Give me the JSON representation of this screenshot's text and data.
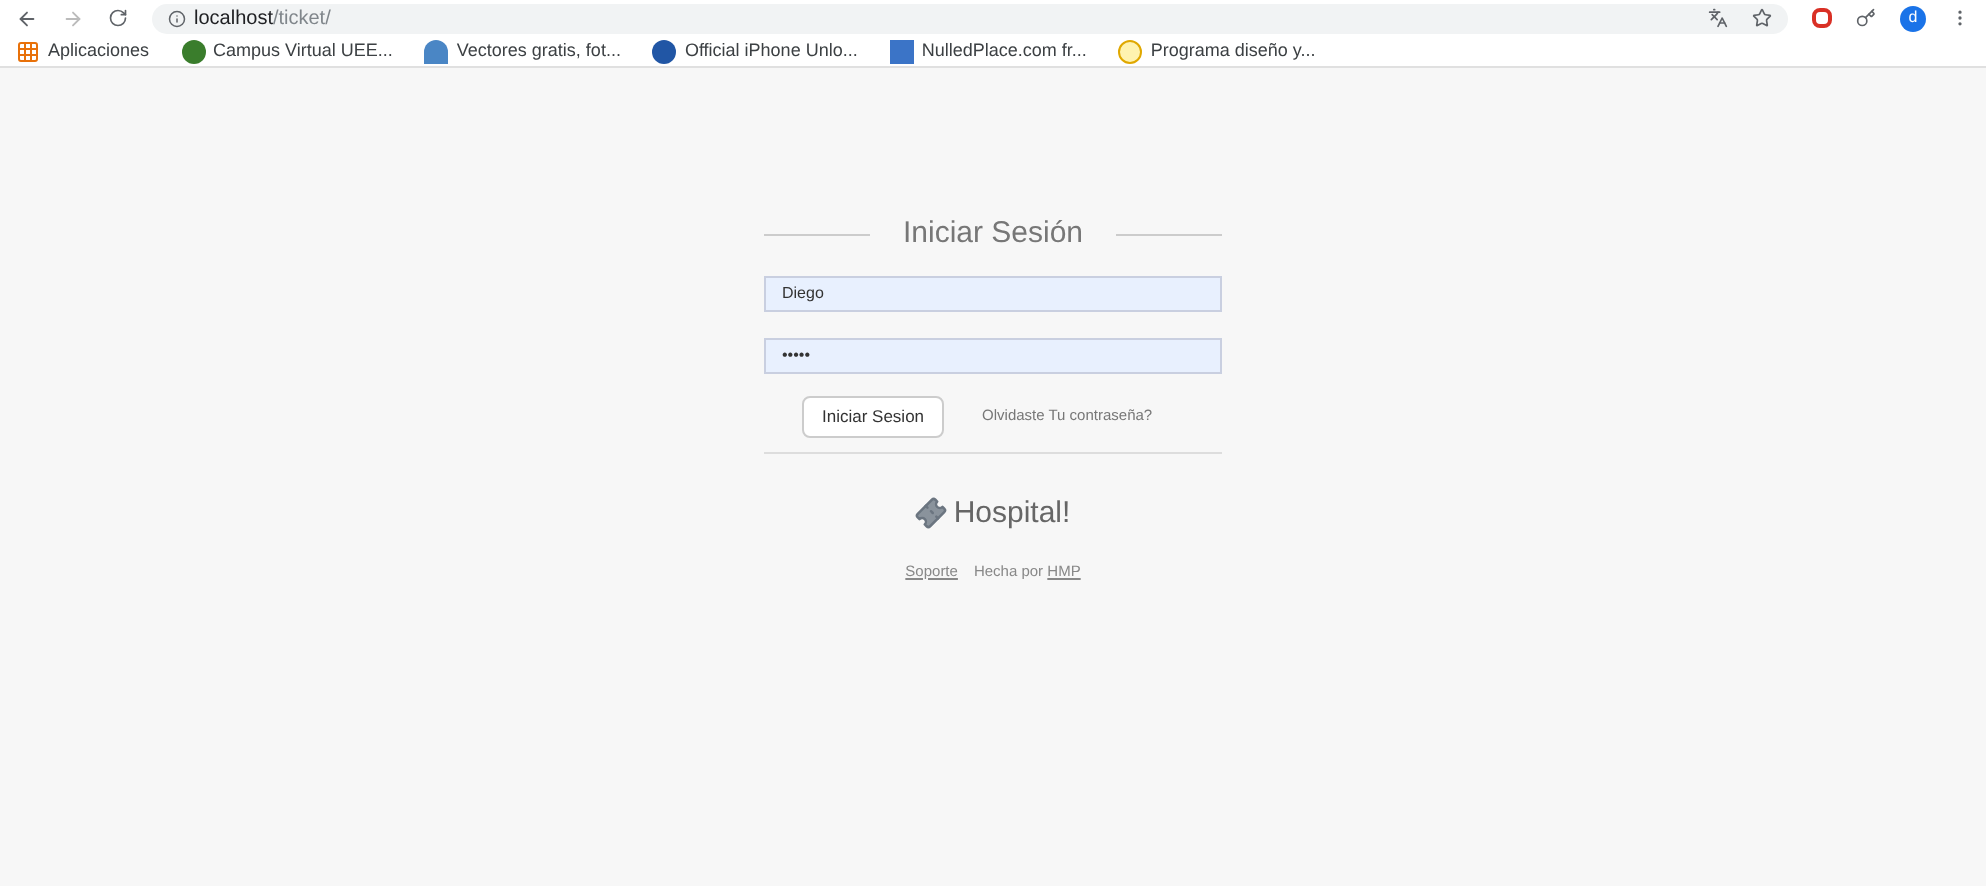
{
  "browser": {
    "url_host": "localhost",
    "url_path": "/ticket/",
    "profile_initial": "d"
  },
  "bookmarks": [
    {
      "label": "Aplicaciones",
      "kind": "apps"
    },
    {
      "label": "Campus Virtual UEE...",
      "kind": "campus"
    },
    {
      "label": "Vectores gratis, fot...",
      "kind": "vector"
    },
    {
      "label": "Official iPhone Unlo...",
      "kind": "iphone"
    },
    {
      "label": "NulledPlace.com fr...",
      "kind": "nulled"
    },
    {
      "label": "Programa diseño y...",
      "kind": "smile"
    }
  ],
  "login": {
    "title": "Iniciar Sesión",
    "username": "Diego",
    "password": "•••••",
    "submit": "Iniciar Sesion",
    "forgot": "Olvidaste Tu contraseña?"
  },
  "brand": "Hospital!",
  "footer": {
    "support": "Soporte",
    "credit_prefix": "Hecha por",
    "credit_link": "HMP"
  }
}
